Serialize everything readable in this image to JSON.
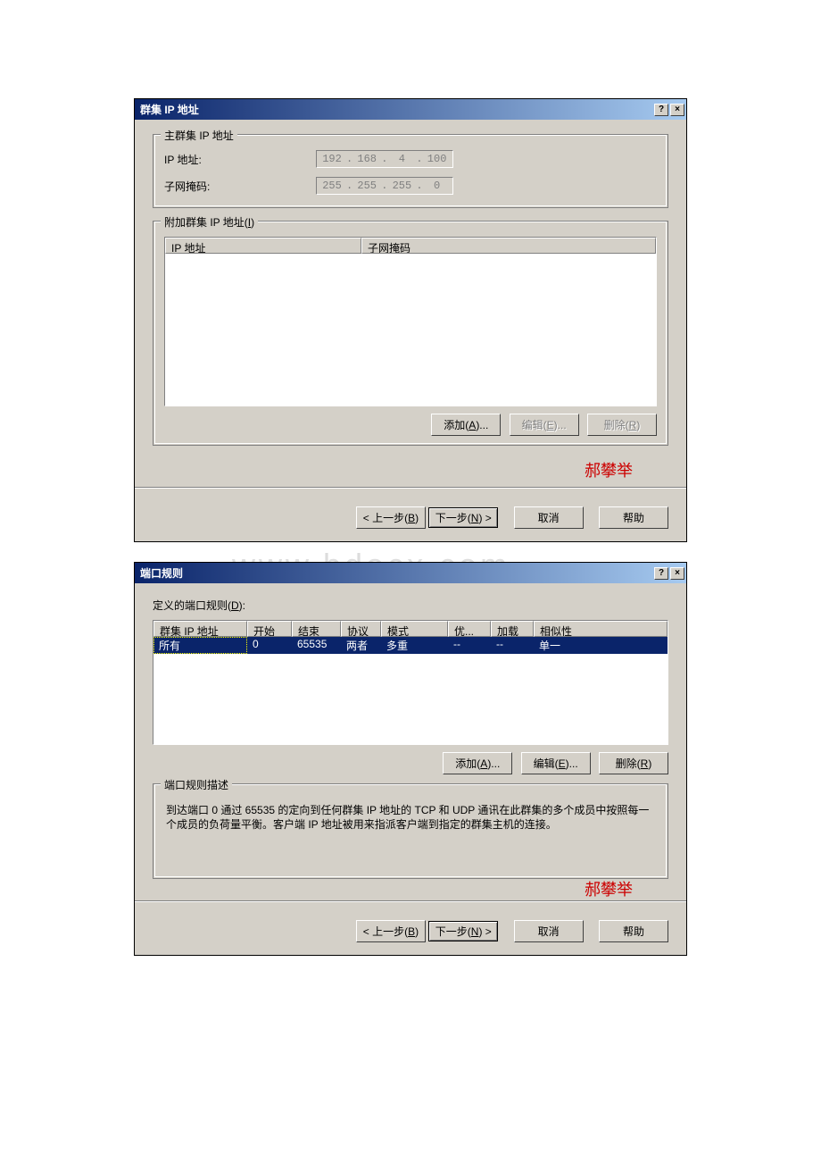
{
  "watermark": "www.bdocx.com",
  "dialog1": {
    "title": "群集 IP 地址",
    "help_btn": "?",
    "close_btn": "×",
    "group_main": {
      "legend": "主群集 IP 地址",
      "ip_label": "IP 地址:",
      "ip_oct": [
        "192",
        "168",
        "4",
        "100"
      ],
      "mask_label": "子网掩码:",
      "mask_oct": [
        "255",
        "255",
        "255",
        "0"
      ]
    },
    "group_add": {
      "legend_prefix": "附加群集 IP 地址(",
      "legend_mnemonic": "I",
      "legend_suffix": ")",
      "col_ip": "IP 地址",
      "col_mask": "子网掩码",
      "add_prefix": "添加(",
      "add_m": "A",
      "add_suffix": ")...",
      "edit_prefix": "编辑(",
      "edit_m": "E",
      "edit_suffix": ")...",
      "del_prefix": "删除(",
      "del_m": "R",
      "del_suffix": ")"
    },
    "signature": "郝攀举",
    "back_prefix": "< 上一步(",
    "back_m": "B",
    "back_suffix": ")",
    "next_prefix": "下一步(",
    "next_m": "N",
    "next_suffix": ") >",
    "cancel": "取消",
    "help": "帮助"
  },
  "dialog2": {
    "title": "端口规则",
    "label_prefix": "定义的端口规则(",
    "label_m": "D",
    "label_suffix": "):",
    "cols": {
      "c0": "群集 IP 地址",
      "c1": "开始",
      "c2": "结束",
      "c3": "协议",
      "c4": "模式",
      "c5": "优...",
      "c6": "加载",
      "c7": "相似性"
    },
    "row": {
      "c0": "所有",
      "c1": "0",
      "c2": "65535",
      "c3": "两者",
      "c4": "多重",
      "c5": "--",
      "c6": "--",
      "c7": "单一"
    },
    "add_prefix": "添加(",
    "add_m": "A",
    "add_suffix": ")...",
    "edit_prefix": "编辑(",
    "edit_m": "E",
    "edit_suffix": ")...",
    "del_prefix": "删除(",
    "del_m": "R",
    "del_suffix": ")",
    "desc_legend": "端口规则描述",
    "desc_text": "到达端口 0 通过 65535 的定向到任何群集 IP 地址的 TCP 和 UDP 通讯在此群集的多个成员中按照每一个成员的负荷量平衡。客户端 IP 地址被用来指派客户端到指定的群集主机的连接。",
    "signature": "郝攀举",
    "back_prefix": "< 上一步(",
    "back_m": "B",
    "back_suffix": ")",
    "next_prefix": "下一步(",
    "next_m": "N",
    "next_suffix": ") >",
    "cancel": "取消",
    "help": "帮助"
  }
}
